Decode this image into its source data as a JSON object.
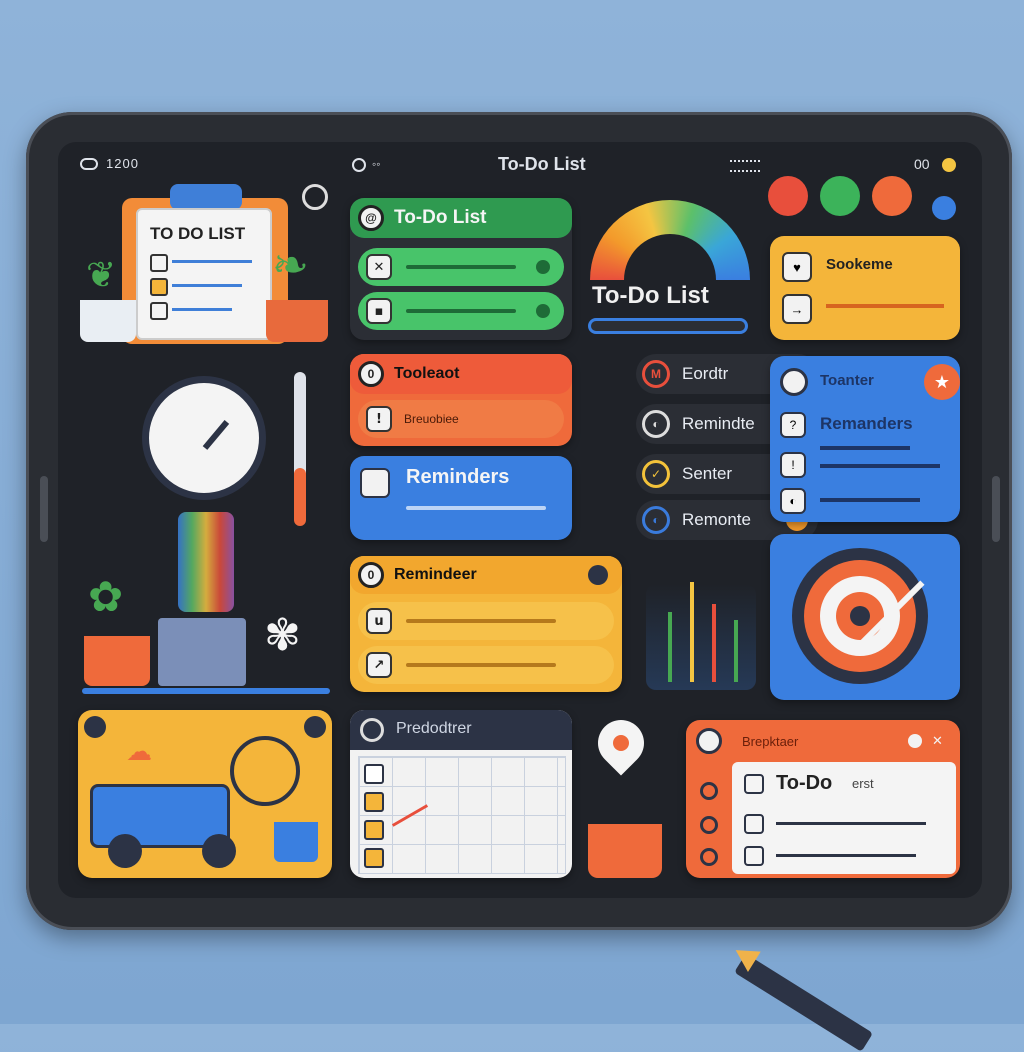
{
  "statusbar": {
    "left_text": "1200",
    "center_title": "To-Do List",
    "right_text": "00"
  },
  "todo_card": {
    "title": "TO DO LIST"
  },
  "green_card": {
    "title": "To-Do List",
    "items": [
      "✕",
      "▪"
    ]
  },
  "gauge": {
    "title": "To-Do List"
  },
  "orange_card": {
    "title": "Tooleaot",
    "items": [
      "!"
    ],
    "caption": "Breuobiee"
  },
  "blue_card": {
    "title": "Reminders"
  },
  "categories": [
    {
      "label": "Eordtr",
      "icon": "M",
      "color": "#e84f3c",
      "end": "#3aa0e6"
    },
    {
      "label": "Remindte",
      "icon": "◐",
      "color": "#444",
      "end": "#f39a2b"
    },
    {
      "label": "Senter",
      "icon": "✓",
      "color": "#f3c23a",
      "end": "#3aa0e6"
    },
    {
      "label": "Remonte",
      "icon": "◐",
      "color": "#3a7bdc",
      "end": "#f39a2b"
    }
  ],
  "right_yellow": {
    "title": "Sookeme",
    "items": [
      "♥",
      "→"
    ]
  },
  "right_blue": {
    "title": "Toanter",
    "subtitle": "Remanders",
    "items": [
      "?",
      "!",
      "◐"
    ]
  },
  "yellow_card": {
    "title": "Remindeer",
    "items": [
      "u",
      "↗"
    ]
  },
  "calendar": {
    "title": "Predodtrer"
  },
  "todo_panel": {
    "header": "Brepktaer",
    "title": "To-Do",
    "title_suffix": "erst"
  },
  "colors": {
    "accent_green": "#3cb35a",
    "accent_orange": "#ef6a3b",
    "accent_blue": "#3a7fe0",
    "accent_yellow": "#f4b53a"
  },
  "icons": [
    "alarm-clock-icon",
    "wrench-icon",
    "target-icon",
    "truck-icon",
    "gauge-icon",
    "calendar-icon",
    "pencil-icon",
    "location-pin-icon",
    "plant-icon"
  ]
}
